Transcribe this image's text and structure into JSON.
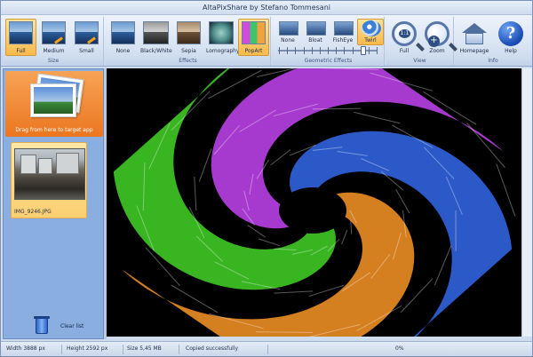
{
  "window": {
    "title": "AltaPixShare by Stefano Tommesani"
  },
  "ribbon": {
    "size_group": {
      "label": "Size",
      "buttons": [
        "Full",
        "Medium",
        "Small"
      ],
      "selected": "Full"
    },
    "effects_group": {
      "label": "Effects",
      "buttons": [
        "None",
        "Black/White",
        "Sepia",
        "Lomography",
        "PopArt"
      ],
      "selected": "PopArt"
    },
    "geometric_group": {
      "label": "Geometric Effects",
      "buttons": [
        "None",
        "Bloat",
        "FishEye",
        "Twirl"
      ],
      "selected": "Twirl",
      "slider_level_fraction": 0.88
    },
    "view_group": {
      "label": "View",
      "buttons": [
        "Full",
        "Zoom"
      ]
    },
    "info_group": {
      "label": "Info",
      "buttons": [
        "Homepage",
        "Help"
      ]
    }
  },
  "sidebar": {
    "drag_label": "Drag from here to target app",
    "file": {
      "name": "IMG_9246.JPG"
    },
    "clear_label": "Clear list"
  },
  "image": {
    "effect": "twirl-popart",
    "colors": {
      "purple": "#b53fe0",
      "blue": "#2f62d9",
      "green": "#3ec424",
      "orange": "#e68a23",
      "background": "#000000"
    }
  },
  "status": {
    "width": "Width 3888 px",
    "height": "Height 2592 px",
    "size": "Size 5,45 MB",
    "message": "Copied successfully",
    "progress": "0%"
  },
  "icons": {
    "view_full": "zoom-fit-icon",
    "view_zoom": "zoom-in-icon",
    "homepage": "home-icon",
    "help": "help-icon",
    "clear": "trash-icon"
  }
}
